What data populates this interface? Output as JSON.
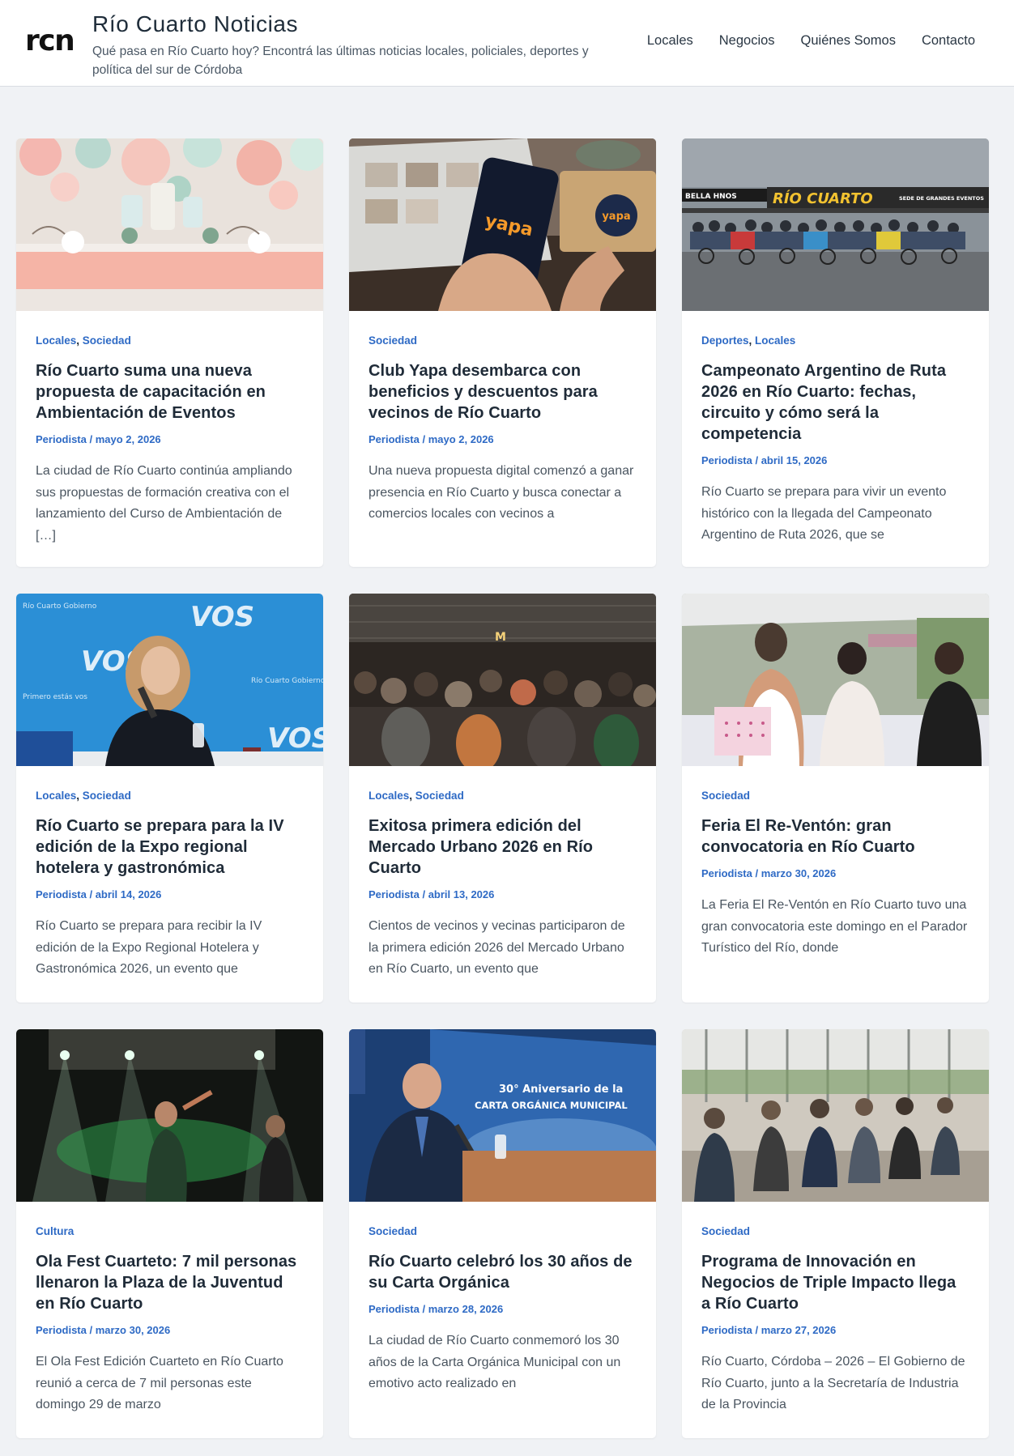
{
  "header": {
    "logo": "rcn",
    "title": "Río Cuarto Noticias",
    "description": "Qué pasa en Río Cuarto hoy? Encontrá las últimas noticias locales, policiales, deportes y política del sur de Córdoba",
    "nav": [
      "Locales",
      "Negocios",
      "Quiénes Somos",
      "Contacto"
    ]
  },
  "posts": [
    {
      "categories": [
        "Locales",
        "Sociedad"
      ],
      "title": "Río Cuarto suma una nueva propuesta de capacitación en Ambientación de Eventos",
      "author": "Periodista",
      "date": "mayo 2, 2026",
      "excerpt": "La ciudad de Río Cuarto continúa ampliando sus propuestas de formación creativa con el lanzamiento del Curso de Ambientación de […]"
    },
    {
      "categories": [
        "Sociedad"
      ],
      "title": "Club Yapa desembarca con beneficios y descuentos para vecinos de Río Cuarto",
      "author": "Periodista",
      "date": "mayo 2, 2026",
      "excerpt": "Una nueva propuesta digital comenzó a ganar presencia en Río Cuarto y busca conectar a comercios locales con vecinos a"
    },
    {
      "categories": [
        "Deportes",
        "Locales"
      ],
      "title": "Campeonato Argentino de Ruta 2026 en Río Cuarto: fechas, circuito y cómo será la competencia",
      "author": "Periodista",
      "date": "abril 15, 2026",
      "excerpt": "Río Cuarto se prepara para vivir un evento histórico con la llegada del Campeonato Argentino de Ruta 2026, que se"
    },
    {
      "categories": [
        "Locales",
        "Sociedad"
      ],
      "title": "Río Cuarto se prepara para la IV edición de la Expo regional hotelera y gastronómica",
      "author": "Periodista",
      "date": "abril 14, 2026",
      "excerpt": "Río Cuarto se prepara para recibir la IV edición de la Expo Regional Hotelera y Gastronómica 2026, un evento que"
    },
    {
      "categories": [
        "Locales",
        "Sociedad"
      ],
      "title": "Exitosa primera edición del Mercado Urbano 2026 en Río Cuarto",
      "author": "Periodista",
      "date": "abril 13, 2026",
      "excerpt": "Cientos de vecinos y vecinas participaron de la primera edición 2026 del Mercado Urbano en Río Cuarto, un evento que"
    },
    {
      "categories": [
        "Sociedad"
      ],
      "title": "Feria El Re-Ventón: gran convocatoria en Río Cuarto",
      "author": "Periodista",
      "date": "marzo 30, 2026",
      "excerpt": "La Feria El Re-Ventón en Río Cuarto tuvo una gran convocatoria este domingo en el Parador Turístico del Río, donde"
    },
    {
      "categories": [
        "Cultura"
      ],
      "title": "Ola Fest Cuarteto: 7 mil personas llenaron la Plaza de la Juventud en Río Cuarto",
      "author": "Periodista",
      "date": "marzo 30, 2026",
      "excerpt": "El Ola Fest Edición Cuarteto en Río Cuarto reunió a cerca de 7 mil personas este domingo 29 de marzo"
    },
    {
      "categories": [
        "Sociedad"
      ],
      "title": "Río Cuarto celebró los 30 años de su Carta Orgánica",
      "author": "Periodista",
      "date": "marzo 28, 2026",
      "excerpt": "La ciudad de Río Cuarto conmemoró los 30 años de la Carta Orgánica Municipal con un emotivo acto realizado en"
    },
    {
      "categories": [
        "Sociedad"
      ],
      "title": "Programa de Innovación en Negocios de Triple Impacto llega a Río Cuarto",
      "author": "Periodista",
      "date": "marzo 27, 2026",
      "excerpt": "Río Cuarto, Córdoba – 2026 – El Gobierno de Río Cuarto, junto a la Secretaría de Industria de la Provincia"
    }
  ],
  "images": {
    "yapa_text": "yapa",
    "banner_text": "RÍO CUARTO",
    "banner_sub": "SEDE DE GRANDES EVENTOS",
    "banner_left": "BELLA HNOS",
    "vos_text": "VOS",
    "vos_sub": "Río Cuarto Gobierno",
    "vos_tag": "Primero estás vos",
    "anniv_line1": "30° Aniversario de la",
    "anniv_line2": "CARTA ORGÁNICA MUNICIPAL"
  }
}
